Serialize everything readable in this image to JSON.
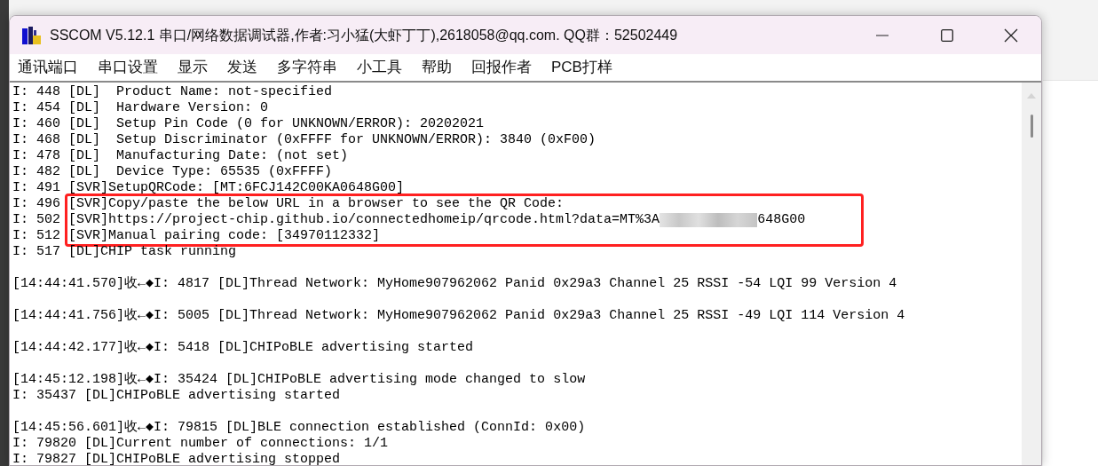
{
  "window": {
    "title": "SSCOM V5.12.1 串口/网络数据调试器,作者:习小猛(大虾丁丁),2618058@qq.com. QQ群：52502449"
  },
  "menu": [
    "通讯端口",
    "串口设置",
    "显示",
    "发送",
    "多字符串",
    "小工具",
    "帮助",
    "回报作者",
    "PCB打样"
  ],
  "messages": [
    {
      "segments": [
        {
          "kind": "plain",
          "lines": [
            "I: 448 [DL]  Product Name: not-specified",
            "I: 454 [DL]  Hardware Version: 0",
            "I: 460 [DL]  Setup Pin Code (0 for UNKNOWN/ERROR): 20202021",
            "I: 468 [DL]  Setup Discriminator (0xFFFF for UNKNOWN/ERROR): 3840 (0xF00)",
            "I: 478 [DL]  Manufacturing Date: (not set)",
            "I: 482 [DL]  Device Type: 65535 (0xFFFF)",
            "I: 491 [SVR]SetupQRCode: [MT:6FCJ142C00KA0648G00]"
          ]
        },
        {
          "kind": "highlighted",
          "lines": [
            {
              "prefix": "I: 496 ",
              "text": "[SVR]Copy/paste the below URL in a browser to see the QR Code:"
            },
            {
              "prefix": "I: 502 ",
              "text": "[SVR]https://project-chip.github.io/connectedhomeip/qrcode.html?data=MT%3A",
              "text_after": "648G00"
            },
            {
              "prefix": "I: 512 ",
              "text": "[SVR]Manual pairing code: [34970112332]"
            }
          ]
        },
        {
          "kind": "plain",
          "lines": [
            "I: 517 [DL]CHIP task running"
          ]
        }
      ]
    },
    {
      "segments": [
        {
          "kind": "plain",
          "lines": [
            "[14:44:41.570]收←◆I: 4817 [DL]Thread Network: MyHome907962062 Panid 0x29a3 Channel 25 RSSI -54 LQI 99 Version 4"
          ]
        }
      ]
    },
    {
      "segments": [
        {
          "kind": "plain",
          "lines": [
            "[14:44:41.756]收←◆I: 5005 [DL]Thread Network: MyHome907962062 Panid 0x29a3 Channel 25 RSSI -49 LQI 114 Version 4"
          ]
        }
      ]
    },
    {
      "segments": [
        {
          "kind": "plain",
          "lines": [
            "[14:44:42.177]收←◆I: 5418 [DL]CHIPoBLE advertising started"
          ]
        }
      ]
    },
    {
      "segments": [
        {
          "kind": "plain",
          "lines": [
            "[14:45:12.198]收←◆I: 35424 [DL]CHIPoBLE advertising mode changed to slow",
            "I: 35437 [DL]CHIPoBLE advertising started"
          ]
        }
      ]
    },
    {
      "segments": [
        {
          "kind": "plain",
          "lines": [
            "[14:45:56.601]收←◆I: 79815 [DL]BLE connection established (ConnId: 0x00)",
            "I: 79820 [DL]Current number of connections: 1/1",
            "I: 79827 [DL]CHIPoBLE advertising stopped"
          ]
        }
      ]
    }
  ]
}
